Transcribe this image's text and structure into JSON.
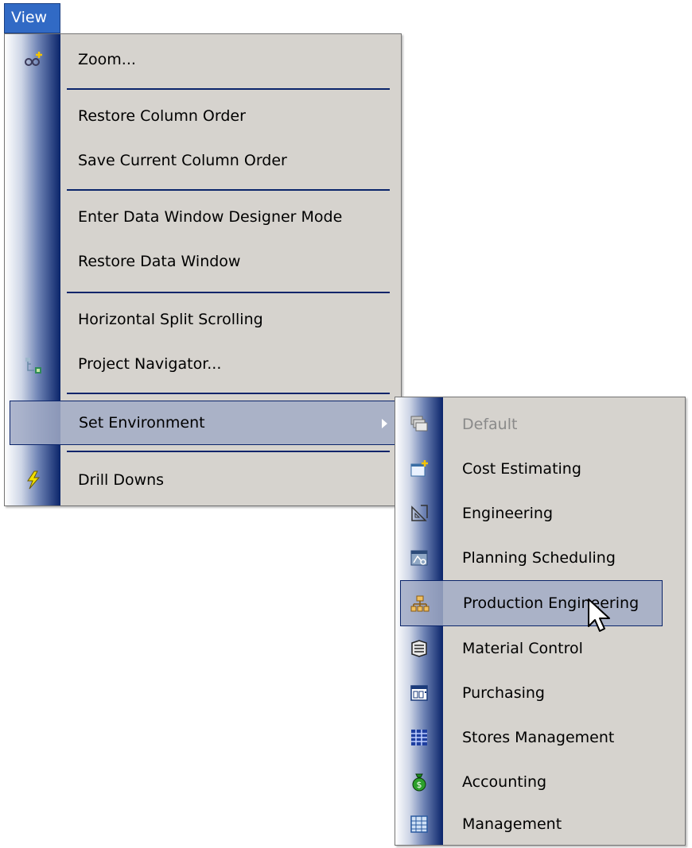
{
  "menubar": {
    "view_label": "View"
  },
  "view_menu": {
    "items": [
      {
        "label": "Zoom...",
        "icon": "zoom-glasses-icon"
      },
      {
        "label": "Restore Column Order"
      },
      {
        "label": "Save Current Column Order"
      },
      {
        "label": "Enter Data Window Designer Mode"
      },
      {
        "label": "Restore Data Window"
      },
      {
        "label": "Horizontal Split Scrolling"
      },
      {
        "label": "Project Navigator...",
        "icon": "tree-icon"
      },
      {
        "label": "Set Environment",
        "state": "highlighted",
        "has_submenu": true
      },
      {
        "label": "Drill Downs",
        "icon": "lightning-icon"
      }
    ]
  },
  "environment_submenu": {
    "items": [
      {
        "label": "Default",
        "state": "disabled",
        "icon": "stacked-windows-icon"
      },
      {
        "label": "Cost Estimating",
        "icon": "new-window-icon"
      },
      {
        "label": "Engineering",
        "icon": "drafting-icon"
      },
      {
        "label": "Planning  Scheduling",
        "icon": "planning-window-icon"
      },
      {
        "label": "Production Engineering",
        "state": "highlighted",
        "icon": "production-icon"
      },
      {
        "label": "Material Control",
        "icon": "material-icon"
      },
      {
        "label": "Purchasing",
        "icon": "calendar-icon"
      },
      {
        "label": "Stores Management",
        "icon": "grid-blocks-icon"
      },
      {
        "label": "Accounting",
        "icon": "money-bag-icon"
      },
      {
        "label": "Management",
        "icon": "spreadsheet-icon"
      }
    ]
  },
  "colors": {
    "menu_bg": "#d6d3ce",
    "highlight": "#a2acc5",
    "accent": "#0a246a",
    "menubar_selected": "#316ac5"
  }
}
